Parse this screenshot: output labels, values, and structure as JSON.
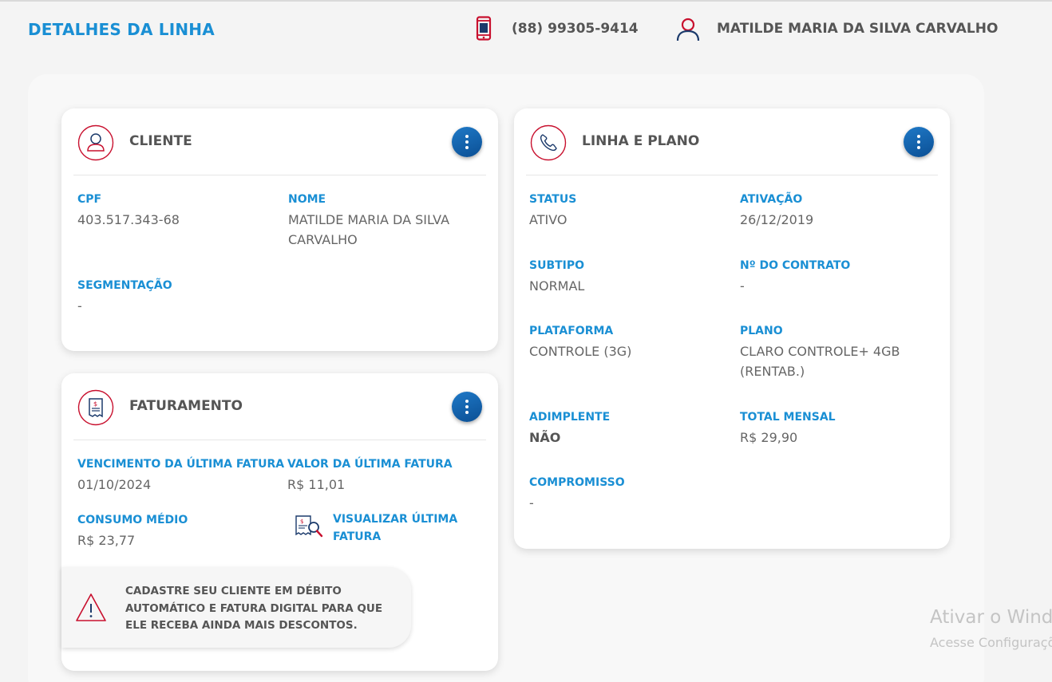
{
  "header": {
    "title": "DETALHES DA LINHA",
    "phone": "(88) 99305-9414",
    "user_name": "MATILDE MARIA DA SILVA CARVALHO",
    "phone_icon": "mobile-phone-icon",
    "user_icon": "user-outline-icon"
  },
  "cliente": {
    "title": "CLIENTE",
    "icon": "user-circle-icon",
    "cpf_label": "CPF",
    "cpf": "403.517.343-68",
    "nome_label": "NOME",
    "nome": "MATILDE MARIA DA SILVA CARVALHO",
    "segmentacao_label": "SEGMENTAÇÃO",
    "segmentacao": "-"
  },
  "faturamento": {
    "title": "FATURAMENTO",
    "icon": "invoice-circle-icon",
    "venc_label": "VENCIMENTO DA ÚLTIMA FATURA",
    "venc": "01/10/2024",
    "valor_label": "VALOR DA ÚLTIMA FATURA",
    "valor": "R$ 11,01",
    "consumo_label": "CONSUMO MÉDIO",
    "consumo": "R$ 23,77",
    "view_invoice": "VISUALIZAR ÚLTIMA FATURA",
    "banner": "CADASTRE SEU CLIENTE EM DÉBITO AUTOMÁTICO E FATURA DIGITAL PARA QUE ELE RECEBA AINDA MAIS DESCONTOS."
  },
  "linha": {
    "title": "LINHA E PLANO",
    "icon": "phone-circle-icon",
    "status_label": "STATUS",
    "status": "ATIVO",
    "ativacao_label": "ATIVAÇÃO",
    "ativacao": "26/12/2019",
    "subtipo_label": "SUBTIPO",
    "subtipo": "NORMAL",
    "contrato_label": "Nº DO CONTRATO",
    "contrato": "-",
    "plataforma_label": "PLATAFORMA",
    "plataforma": "CONTROLE (3G)",
    "plano_label": "PLANO",
    "plano": "CLARO CONTROLE+ 4GB (RENTAB.)",
    "adimplente_label": "ADIMPLENTE",
    "adimplente": "NÃO",
    "total_label": "TOTAL MENSAL",
    "total": "R$ 29,90",
    "compromisso_label": "COMPROMISSO",
    "compromisso": "-"
  },
  "watermark": {
    "line1": "Ativar o Windows",
    "line2": "Acesse Configurações"
  },
  "colors": {
    "accent_blue": "#1a8fd4",
    "button_blue": "#0b4f94",
    "icon_red": "#c8102e",
    "icon_navy": "#1b3a6b"
  }
}
